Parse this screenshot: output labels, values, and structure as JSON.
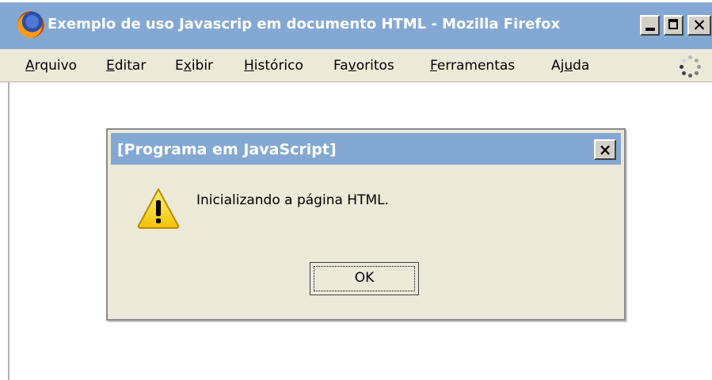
{
  "window": {
    "title": "Exemplo de uso Javascrip em documento HTML - Mozilla Firefox",
    "icon": "firefox-icon",
    "controls": {
      "minimize": "minimize-icon",
      "maximize": "maximize-icon",
      "close": "close-icon"
    }
  },
  "menubar": {
    "items": [
      {
        "pre": "",
        "u": "A",
        "post": "rquivo"
      },
      {
        "pre": "",
        "u": "E",
        "post": "ditar"
      },
      {
        "pre": "E",
        "u": "x",
        "post": "ibir"
      },
      {
        "pre": "",
        "u": "H",
        "post": "istórico"
      },
      {
        "pre": "Fa",
        "u": "v",
        "post": "oritos"
      },
      {
        "pre": "",
        "u": "F",
        "post": "erramentas"
      },
      {
        "pre": "Aj",
        "u": "u",
        "post": "da"
      }
    ]
  },
  "dialog": {
    "title": "[Programa em JavaScript]",
    "message": "Inicializando a página HTML.",
    "icon": "warning-icon",
    "ok_label": "OK",
    "close_glyph": "×"
  },
  "colors": {
    "titlebar": "#84a8d4",
    "dialog_bg": "#ece9d8",
    "menubar_bg": "#ece9d8"
  }
}
